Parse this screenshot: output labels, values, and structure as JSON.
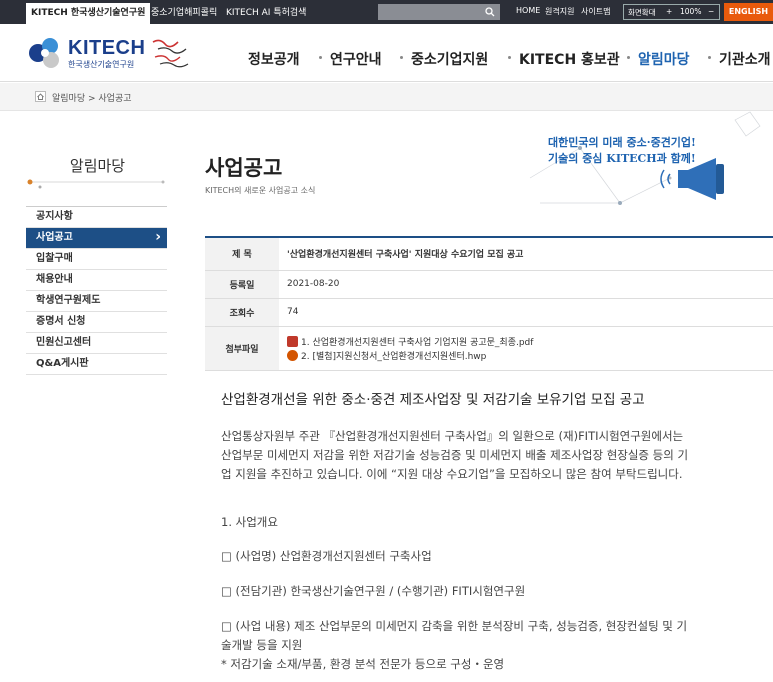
{
  "topbar": {
    "sites": [
      "KITECH 한국생산기술연구원",
      "중소기업해피콜릭",
      "KITECH AI 특허검색"
    ],
    "links": [
      "HOME",
      "원격지원",
      "사이트맵"
    ],
    "zoom": {
      "label": "화면확대",
      "plus": "+",
      "value": "100%",
      "minus": "−"
    },
    "english": "ENGLISH"
  },
  "header": {
    "logo_title": "KITECH",
    "logo_subtitle": "한국생산기술연구원",
    "nav": [
      "정보공개",
      "연구안내",
      "중소기업지원",
      "KITECH 홍보관",
      "알림마당",
      "기관소개"
    ],
    "active_nav": "알림마당"
  },
  "breadcrumb": "알림마당 > 사업공고",
  "sidebar": {
    "title": "알림마당",
    "items": [
      "공지사항",
      "사업공고",
      "입찰구매",
      "채용안내",
      "학생연구원제도",
      "증명서 신청",
      "민원신고센터",
      "Q&A게시판"
    ],
    "active": "사업공고"
  },
  "page": {
    "title": "사업공고",
    "subtitle": "KITECH의 새로운 사업공고 소식",
    "promo_line1": "대한민국의 미래 중소·중견기업!",
    "promo_line2": "기술의 중심 KITECH과 함께!"
  },
  "post": {
    "labels": {
      "subject": "제  목",
      "date": "등록일",
      "views": "조회수",
      "attach": "첨부파일"
    },
    "subject": "'산업환경개선지원센터 구축사업' 지원대상 수요기업 모집 공고",
    "date": "2021-08-20",
    "views": "74",
    "attachments": [
      "1. 산업환경개선지원센터 구축사업 기업지원 공고문_최종.pdf",
      "2. [별첨]지원신청서_산업환경개선지원센터.hwp"
    ]
  },
  "content": {
    "heading": "산업환경개선을 위한 중소‧중견 제조사업장 및 저감기술 보유기업 모집 공고",
    "intro": [
      "산업통상자원부 주관 『산업환경개선지원센터 구축사업』의 일환으로 (재)FITI시험연구원에서는",
      "산업부문 미세먼지 저감을 위한 저감기술 성능검증 및 미세먼지 배출 제조사업장 현장실증 등의 기",
      "업 지원을 추진하고 있습니다. 이에 “지원 대상 수요기업”을 모집하오니 많은 참여 부탁드립니다."
    ],
    "section1": "1. 사업개요",
    "item1": "□ (사업명) 산업환경개선지원센터 구축사업",
    "item2": "□ (전담기관) 한국생산기술연구원 / (수행기관) FITI시험연구원",
    "item3": [
      "□ (사업 내용) 제조 산업부문의 미세먼지 감축을 위한 분석장비 구축, 성능검증, 현장컨설팅 및 기",
      "술개발 등을 지원"
    ],
    "item3_sub": "* 저감기술 소재/부품, 환경 분석 전문가 등으로 구성・운영"
  }
}
